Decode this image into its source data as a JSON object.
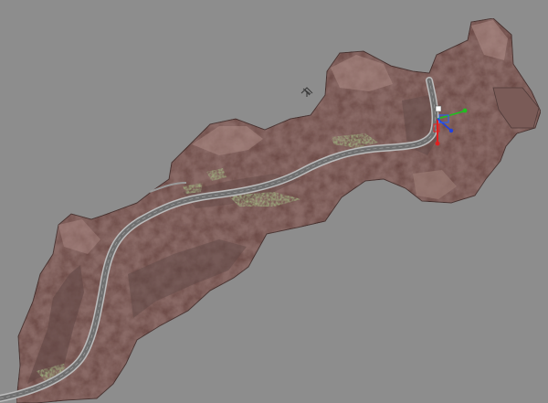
{
  "viewport": {
    "background": "#8d8d8d",
    "view_mode": "perspective"
  },
  "scene": {
    "terrain_color": "#8a6a66",
    "terrain_shadow": "#5e4644",
    "terrain_highlight": "#b3928c",
    "road_color": "#6f6f6f",
    "road_edge_color": "#bdbdbd",
    "vegetation_color": "#6b7a45"
  },
  "gizmo": {
    "x_axis_color": "#e02020",
    "y_axis_color": "#20c020",
    "z_axis_color": "#2040e0",
    "icon": "transform-move-gizmo"
  },
  "light": {
    "icon": "directional-light-icon"
  }
}
